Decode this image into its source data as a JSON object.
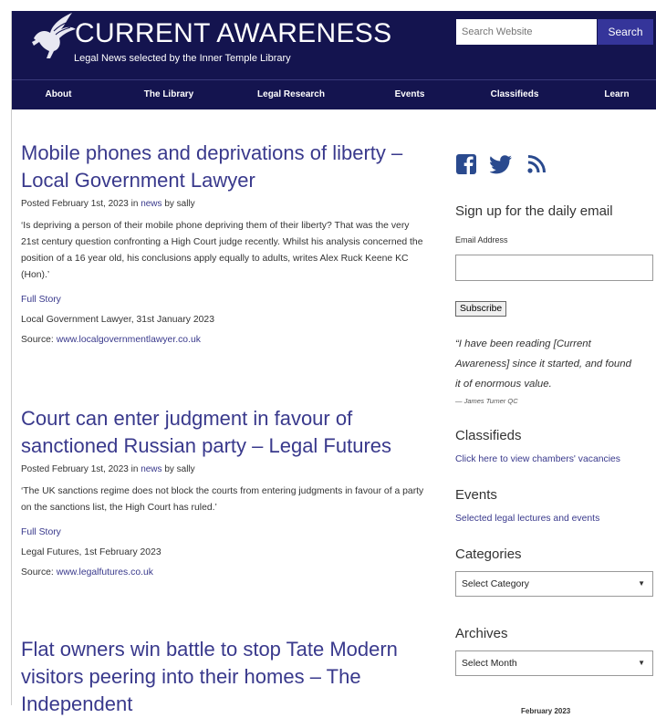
{
  "header": {
    "title": "CURRENT AWARENESS",
    "tagline": "Legal News selected by the Inner Temple Library",
    "search_placeholder": "Search Website",
    "search_button": "Search"
  },
  "nav": [
    "About",
    "The Library",
    "Legal Research",
    "Events",
    "Classifieds",
    "Learn"
  ],
  "posts": [
    {
      "title_line1": "Mobile phones and deprivations of liberty –",
      "title_line2": "Local Government Lawyer",
      "meta_prefix": "Posted February 1st, 2023 in ",
      "meta_category": "news",
      "meta_by": " by ",
      "meta_author": "sally",
      "excerpt_lines": [
        "‘Is depriving a person of their mobile phone depriving them of their liberty? That was the very",
        "21st century question confronting a High Court judge recently. Whilst his analysis concerned the",
        "position of a 16 year old, his conclusions apply equally to adults, writes Alex Ruck Keene KC",
        "(Hon).’"
      ],
      "full_story": "Full Story",
      "source_line": "Local Government Lawyer, 31st January 2023",
      "source_label": "Source: ",
      "source_link": "www.localgovernmentlawyer.co.uk"
    },
    {
      "title_line1": "Court can enter judgment in favour of",
      "title_line2": "sanctioned Russian party – Legal Futures",
      "meta_prefix": "Posted February 1st, 2023 in ",
      "meta_category": "news",
      "meta_by": " by ",
      "meta_author": "sally",
      "excerpt_lines": [
        "‘The UK sanctions regime does not block the courts from entering judgments in favour of a party",
        "on the sanctions list, the High Court has ruled.’"
      ],
      "full_story": "Full Story",
      "source_line": "Legal Futures, 1st February 2023",
      "source_label": "Source: ",
      "source_link": "www.legalfutures.co.uk"
    },
    {
      "title_line1": "Flat owners win battle to stop Tate Modern",
      "title_line2": "visitors peering into their homes – The",
      "title_line3": "Independent"
    }
  ],
  "sidebar": {
    "signup_heading": "Sign up for the daily email",
    "email_label": "Email Address",
    "subscribe_button": "Subscribe",
    "quote_lines": [
      "“I have been reading [Current",
      "Awareness] since it started, and found",
      "it of enormous value."
    ],
    "quote_attribution": "— James Turner QC",
    "classifieds_heading": "Classifieds",
    "classifieds_link": "Click here to view chambers' vacancies",
    "events_heading": "Events",
    "events_link": "Selected legal lectures and events",
    "categories_heading": "Categories",
    "categories_selected": "Select Category",
    "archives_heading": "Archives",
    "archives_selected": "Select Month",
    "calendar_caption": "February 2023"
  },
  "colors": {
    "header_bg": "#14144f",
    "link": "#39398c",
    "search_button_bg": "#35359a"
  },
  "icons": [
    "pegasus-logo-icon",
    "facebook-icon",
    "twitter-icon",
    "rss-icon",
    "chevron-down-icon"
  ]
}
